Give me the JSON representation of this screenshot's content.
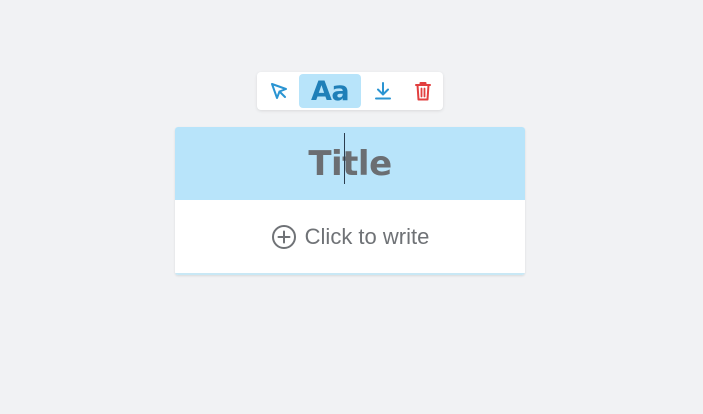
{
  "toolbar": {
    "buttons": [
      {
        "name": "select",
        "icon": "cursor-arrow-icon"
      },
      {
        "name": "text-style",
        "icon": "text-style-icon",
        "label": "Aa",
        "active": true
      },
      {
        "name": "download",
        "icon": "download-icon"
      },
      {
        "name": "delete",
        "icon": "trash-icon"
      }
    ]
  },
  "card": {
    "title": "Title",
    "body_prompt": "Click to write",
    "body_icon": "plus-circle-icon"
  },
  "colors": {
    "page_background": "#f1f2f4",
    "accent": "#2a94d2",
    "header_background": "#b8e4fa",
    "delete": "#e23f3f",
    "text_muted": "#6f7276"
  }
}
